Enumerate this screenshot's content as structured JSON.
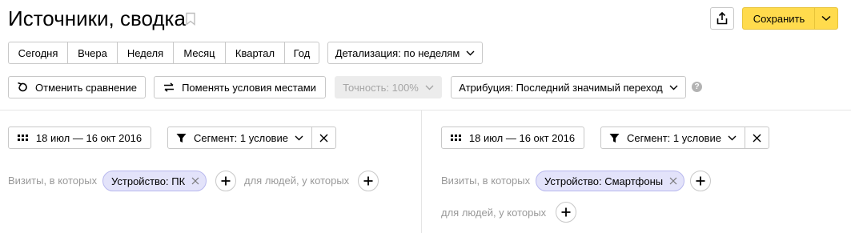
{
  "header": {
    "title": "Источники, сводка",
    "save_label": "Сохранить"
  },
  "periods": [
    "Сегодня",
    "Вчера",
    "Неделя",
    "Месяц",
    "Квартал",
    "Год"
  ],
  "detail_label": "Детализация: по неделям",
  "toolbar": {
    "cancel_compare": "Отменить сравнение",
    "swap_conditions": "Поменять условия местами",
    "accuracy": "Точность: 100%",
    "attribution": "Атрибуция: Последний значимый переход",
    "help": "?"
  },
  "left": {
    "date_range": "18 июл — 16 окт 2016",
    "segment": "Сегмент: 1 условие",
    "visits_label": "Визиты, в которых",
    "chip": "Устройство: ПК",
    "people_label": "для людей, у которых"
  },
  "right": {
    "date_range": "18 июл — 16 окт 2016",
    "segment": "Сегмент: 1 условие",
    "visits_label": "Визиты, в которых",
    "chip": "Устройство: Смартфоны",
    "people_label": "для людей, у которых"
  },
  "icons": {
    "bookmark": "bookmark-icon",
    "share": "share-icon",
    "chevron": "chevron-down-icon",
    "undo": "undo-icon",
    "swap": "swap-icon",
    "calendar": "calendar-icon",
    "filter": "filter-icon",
    "close": "close-icon",
    "plus": "plus-icon"
  },
  "colors": {
    "save_bg": "#ffdb4d",
    "chip_bg": "#e3e3fa",
    "muted_text": "#999999",
    "disabled_bg": "#ececec"
  }
}
